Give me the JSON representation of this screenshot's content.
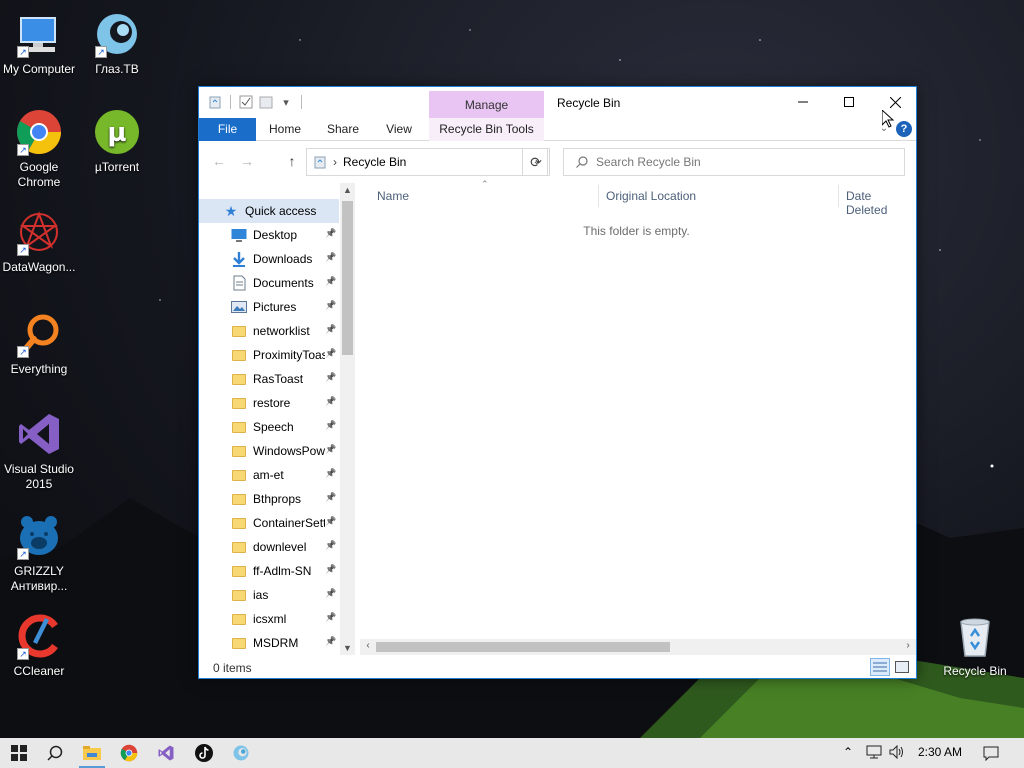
{
  "desktop": {
    "icons": [
      {
        "label": "My Computer",
        "icon": "computer-icon"
      },
      {
        "label": "Глаз.ТВ",
        "icon": "glaz-tv-icon"
      },
      {
        "label": "Google Chrome",
        "icon": "chrome-icon"
      },
      {
        "label": "µTorrent",
        "icon": "utorrent-icon"
      },
      {
        "label": "DataWagon...",
        "icon": "datawagon-icon"
      },
      {
        "label": "Everything",
        "icon": "everything-icon"
      },
      {
        "label": "Visual Studio 2015",
        "icon": "visual-studio-icon"
      },
      {
        "label": "GRIZZLY Антивир...",
        "icon": "grizzly-icon"
      },
      {
        "label": "CCleaner",
        "icon": "ccleaner-icon"
      },
      {
        "label": "Recycle Bin",
        "icon": "recycle-bin-icon"
      }
    ]
  },
  "window": {
    "title": "Recycle Bin",
    "manage_tab": "Manage",
    "ribbon_tabs": {
      "file": "File",
      "home": "Home",
      "share": "Share",
      "view": "View",
      "tools": "Recycle Bin Tools"
    },
    "help": "?",
    "address": {
      "chevron": "›",
      "location": "Recycle Bin"
    },
    "search": {
      "placeholder": "Search Recycle Bin"
    },
    "nav_pane": {
      "quick_access": "Quick access",
      "items": [
        {
          "label": "Desktop",
          "icon": "desktop-icon"
        },
        {
          "label": "Downloads",
          "icon": "downloads-icon"
        },
        {
          "label": "Documents",
          "icon": "documents-icon"
        },
        {
          "label": "Pictures",
          "icon": "pictures-icon"
        },
        {
          "label": "networklist",
          "icon": "folder-icon"
        },
        {
          "label": "ProximityToast",
          "icon": "folder-icon"
        },
        {
          "label": "RasToast",
          "icon": "folder-icon"
        },
        {
          "label": "restore",
          "icon": "folder-icon"
        },
        {
          "label": "Speech",
          "icon": "folder-icon"
        },
        {
          "label": "WindowsPowerShell",
          "icon": "folder-icon"
        },
        {
          "label": "am-et",
          "icon": "folder-icon"
        },
        {
          "label": "Bthprops",
          "icon": "folder-icon"
        },
        {
          "label": "ContainerSettings",
          "icon": "folder-icon"
        },
        {
          "label": "downlevel",
          "icon": "folder-icon"
        },
        {
          "label": "ff-Adlm-SN",
          "icon": "folder-icon"
        },
        {
          "label": "ias",
          "icon": "folder-icon"
        },
        {
          "label": "icsxml",
          "icon": "folder-icon"
        },
        {
          "label": "MSDRM",
          "icon": "folder-icon"
        }
      ]
    },
    "columns": {
      "name": "Name",
      "original_location": "Original Location",
      "date_deleted": "Date Deleted"
    },
    "empty_message": "This folder is empty.",
    "status": {
      "items": "0 items"
    }
  },
  "taskbar": {
    "clock": "2:30 AM",
    "apps": [
      {
        "name": "file-explorer",
        "active": true
      },
      {
        "name": "chrome",
        "active": false
      },
      {
        "name": "visual-studio",
        "active": false
      },
      {
        "name": "tiktok",
        "active": false
      },
      {
        "name": "glaz-tv",
        "active": false
      }
    ]
  },
  "colors": {
    "accent": "#1a6ec9",
    "manage_tab": "#e8c5f2",
    "taskbar": "#e8e8e8"
  }
}
